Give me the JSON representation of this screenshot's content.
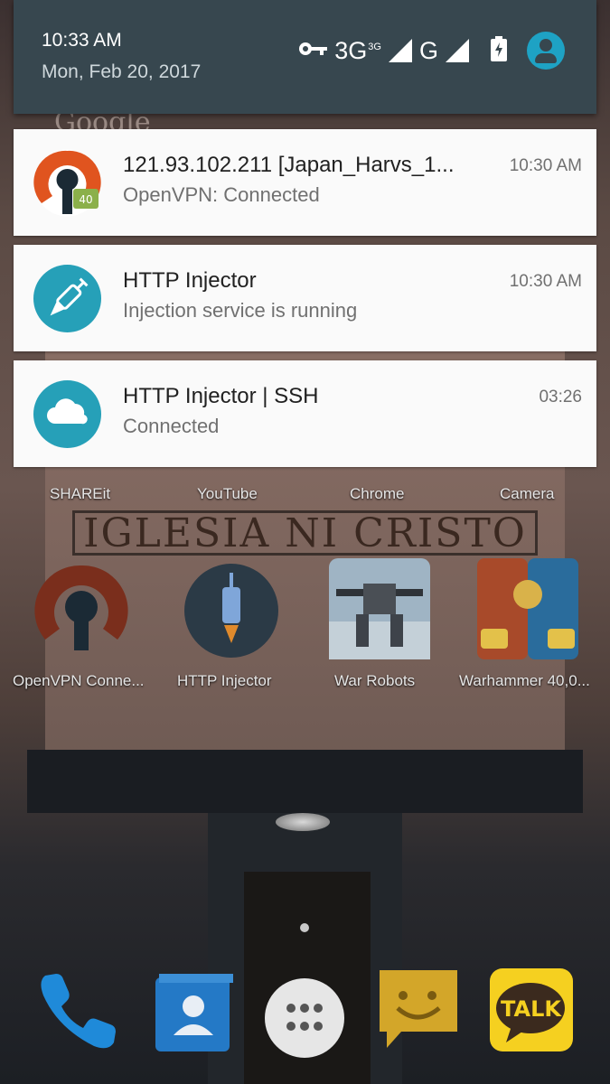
{
  "status": {
    "time": "10:33 AM",
    "date": "Mon, Feb 20, 2017",
    "network_primary": "3G",
    "network_primary_sup": "3G",
    "network_secondary": "G",
    "icons": [
      "vpn-key-icon",
      "signal-icon",
      "signal-icon",
      "battery-charging-icon",
      "account-avatar-icon"
    ]
  },
  "notifications": [
    {
      "title": "121.93.102.211 [Japan_Harvs_1...",
      "subtitle": "OpenVPN: Connected",
      "time": "10:30 AM",
      "icon": "openvpn-icon"
    },
    {
      "title": "HTTP Injector",
      "subtitle": "Injection service is running",
      "time": "10:30 AM",
      "icon": "injector-icon"
    },
    {
      "title": "HTTP Injector | SSH",
      "subtitle": "Connected",
      "time": "03:26",
      "icon": "cloud-icon"
    }
  ],
  "home": {
    "row1_labels": [
      "SHAREit",
      "YouTube",
      "Chrome",
      "Camera"
    ],
    "sign_text": "IGLESIA NI CRISTO",
    "row2_apps": [
      {
        "label": "OpenVPN Conne...",
        "icon": "openvpn-app-icon"
      },
      {
        "label": "HTTP Injector",
        "icon": "http-injector-app-icon"
      },
      {
        "label": "War Robots",
        "icon": "war-robots-app-icon"
      },
      {
        "label": "Warhammer 40,0...",
        "icon": "warhammer-app-icon"
      }
    ],
    "dock": [
      "phone-icon",
      "contacts-icon",
      "app-drawer-icon",
      "messaging-icon",
      "kakaotalk-icon"
    ],
    "kakao_text": "TALK",
    "google_hint": "Google"
  },
  "colors": {
    "shade": "#37474f",
    "accent_teal": "#26a0b8",
    "openvpn_orange": "#e0541f"
  }
}
